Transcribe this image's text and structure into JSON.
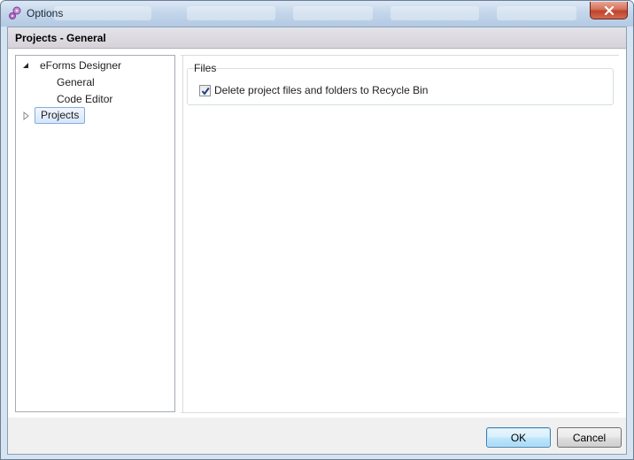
{
  "window": {
    "title": "Options",
    "close_label": "close"
  },
  "header": {
    "title": "Projects - General"
  },
  "tree": {
    "items": [
      {
        "label": "eForms Designer",
        "expanded": true,
        "icon": "expanded-triangle-icon"
      },
      {
        "label": "General"
      },
      {
        "label": "Code Editor"
      },
      {
        "label": "Projects",
        "selected": true,
        "icon": "collapsed-triangle-icon"
      }
    ]
  },
  "files_group": {
    "title": "Files",
    "delete_to_recycle_bin": {
      "label": "Delete project files and folders to Recycle Bin",
      "checked": true
    }
  },
  "buttons": {
    "ok": "OK",
    "cancel": "Cancel"
  },
  "colors": {
    "accent": "#84acdd",
    "ok_border": "#3c7fb1",
    "close_red": "#c1422b"
  }
}
